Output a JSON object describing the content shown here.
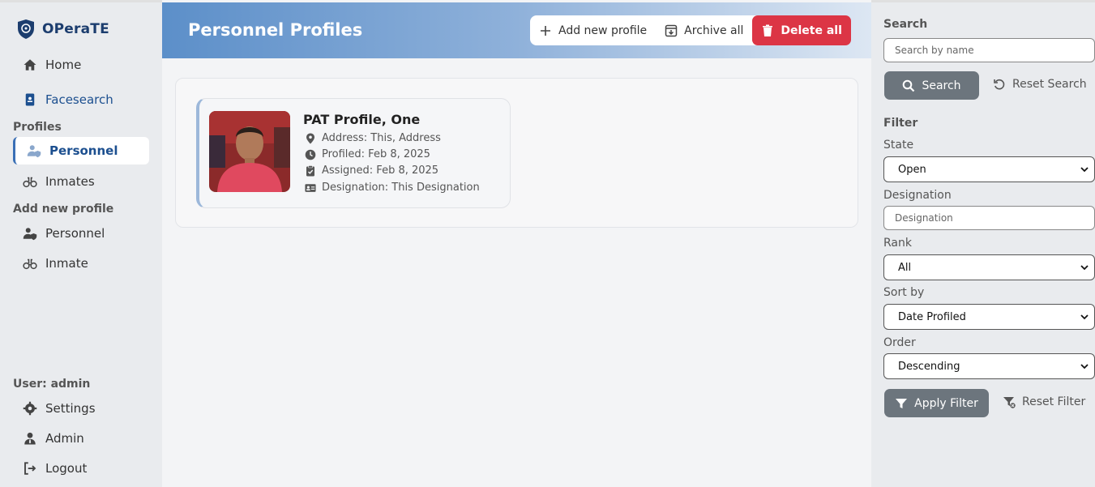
{
  "brand": {
    "name": "OPeraTE"
  },
  "sidebar": {
    "items_top": [
      {
        "label": "Home",
        "icon": "home-icon"
      },
      {
        "label": "Facesearch",
        "icon": "id-badge-icon"
      }
    ],
    "profiles_heading": "Profiles",
    "profiles": [
      {
        "label": "Personnel",
        "icon": "user-shield-icon"
      },
      {
        "label": "Inmates",
        "icon": "binoculars-icon"
      }
    ],
    "add_heading": "Add new profile",
    "add": [
      {
        "label": "Personnel",
        "icon": "user-shield-icon"
      },
      {
        "label": "Inmate",
        "icon": "binoculars-icon"
      }
    ],
    "user_heading": "User: admin",
    "user_items": [
      {
        "label": "Settings",
        "icon": "gear-icon"
      },
      {
        "label": "Admin",
        "icon": "user-tie-icon"
      },
      {
        "label": "Logout",
        "icon": "logout-icon"
      }
    ]
  },
  "header": {
    "title": "Personnel Profiles",
    "add_label": "Add new profile",
    "archive_label": "Archive all",
    "delete_label": "Delete all"
  },
  "profile": {
    "name": "PAT Profile, One",
    "address": "Address: This, Address",
    "profiled": "Profiled: Feb 8, 2025",
    "assigned": "Assigned: Feb 8, 2025",
    "designation": "Designation: This Designation"
  },
  "filters": {
    "search_heading": "Search",
    "search_placeholder": "Search by name",
    "search_label": "Search",
    "reset_search_label": "Reset Search",
    "filter_heading": "Filter",
    "state_label": "State",
    "state_value": "Open",
    "designation_label": "Designation",
    "designation_placeholder": "Designation",
    "rank_label": "Rank",
    "rank_value": "All",
    "sort_label": "Sort by",
    "sort_value": "Date Profiled",
    "order_label": "Order",
    "order_value": "Descending",
    "apply_label": "Apply Filter",
    "reset_filter_label": "Reset Filter"
  },
  "colors": {
    "accent": "#3a6fb5",
    "danger": "#dc3545",
    "brand": "#1c3d6e"
  }
}
